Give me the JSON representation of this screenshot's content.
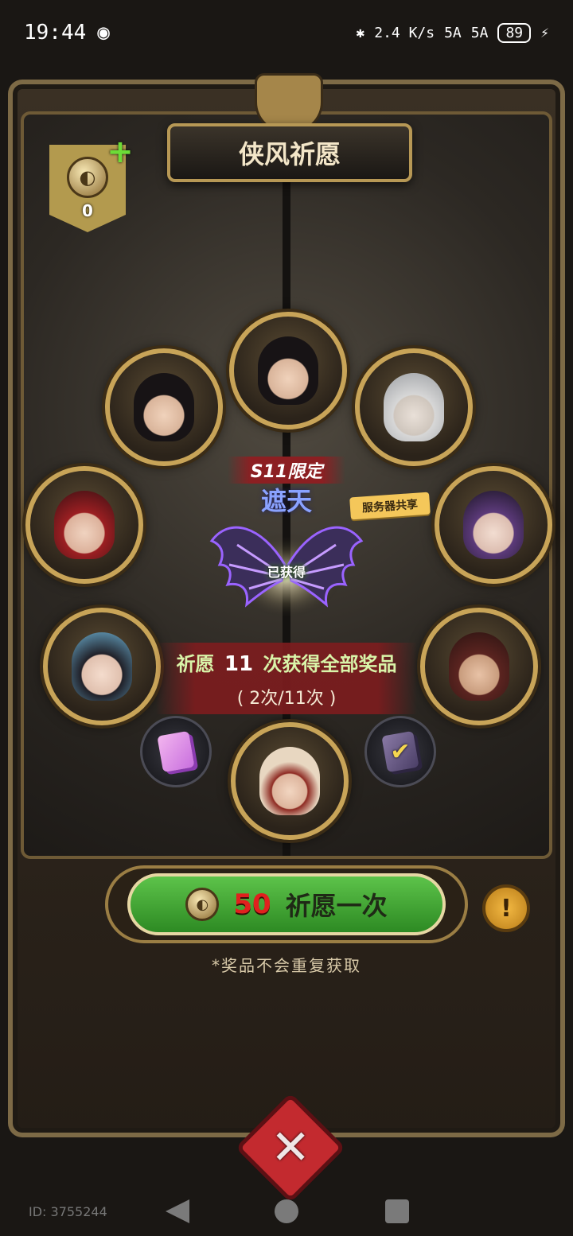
{
  "status_bar": {
    "time": "19:44",
    "net_speed": "2.4 K/s",
    "signal_1": "5A",
    "signal_2": "5A",
    "battery": "89"
  },
  "title": "侠风祈愿",
  "currency": {
    "count": "0",
    "plus": "+"
  },
  "reward": {
    "season_badge": "S11限定",
    "name": "遮天",
    "server_shared": "服务器共享",
    "obtained": "已获得"
  },
  "progress": {
    "prefix": "祈愿",
    "total": "11",
    "suffix": "次获得全部奖品",
    "detail": "( 2次/11次 )"
  },
  "pray_button": {
    "cost": "50",
    "label": "祈愿一次"
  },
  "note": "*奖品不会重复获取",
  "user_id": "ID: 3755244"
}
